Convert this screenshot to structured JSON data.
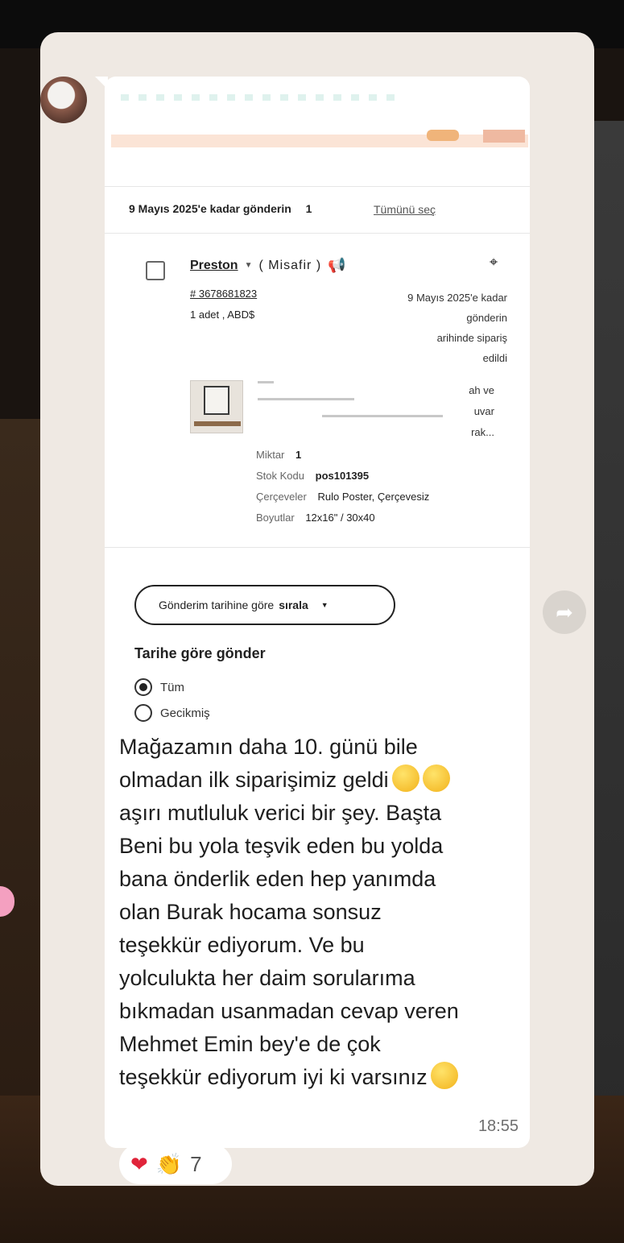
{
  "order_card": {
    "ship_by_label": "9 Mayıs 2025'e kadar gönderin",
    "ship_by_count": "1",
    "select_all": "Tümünü seç",
    "buyer_name": "Preston",
    "buyer_guest": "( Misafir )",
    "order_number": "# 3678681823",
    "quantity_line": "1 adet ,  ABD$",
    "ship_date_lines": [
      "9 Mayıs 2025'e kadar",
      "gönderin",
      "arihinde sipariş",
      "edildi"
    ],
    "title_fragments": [
      "ah ve",
      "uvar",
      "rak..."
    ],
    "specs": [
      {
        "key": "Miktar",
        "value": "1"
      },
      {
        "key": "Stok Kodu",
        "value": "pos101395"
      },
      {
        "key": "Çerçeveler",
        "value": "Rulo Poster, Çerçevesiz"
      },
      {
        "key": "Boyutlar",
        "value": "12x16\" / 30x40"
      }
    ],
    "sort_button_prefix": "Gönderim tarihine göre",
    "sort_button_bold": "sırala",
    "filter_title": "Tarihe göre gönder",
    "filter_options": [
      {
        "label": "Tüm",
        "selected": true
      },
      {
        "label": "Gecikmiş",
        "selected": false
      }
    ]
  },
  "message": {
    "line1": "Mağazamın daha 10. günü bile",
    "line2": "olmadan ilk siparişimiz geldi",
    "line3": "aşırı mutluluk verici bir şey. Başta",
    "line4": "Beni bu yola teşvik eden bu yolda",
    "line5": "bana önderlik eden hep yanımda",
    "line6": "olan Burak hocama sonsuz",
    "line7": "teşekkür ediyorum. Ve bu",
    "line8": "yolculukta her daim sorularıma",
    "line9": "bıkmadan usanmadan cevap veren",
    "line10": "Mehmet Emin bey'e de çok",
    "line11": "teşekkür ediyorum iyi ki varsınız",
    "time": "18:55",
    "emojis": [
      "star-struck-emoji",
      "star-struck-emoji",
      "star-struck-emoji"
    ]
  },
  "reactions": {
    "items": [
      "red-heart",
      "clapping-hands"
    ],
    "count": "7"
  },
  "colors": {
    "chat_background": "#efe9e3",
    "bubble": "#ffffff",
    "text": "#1e1e1e",
    "timestamp": "#6e6e6e"
  }
}
